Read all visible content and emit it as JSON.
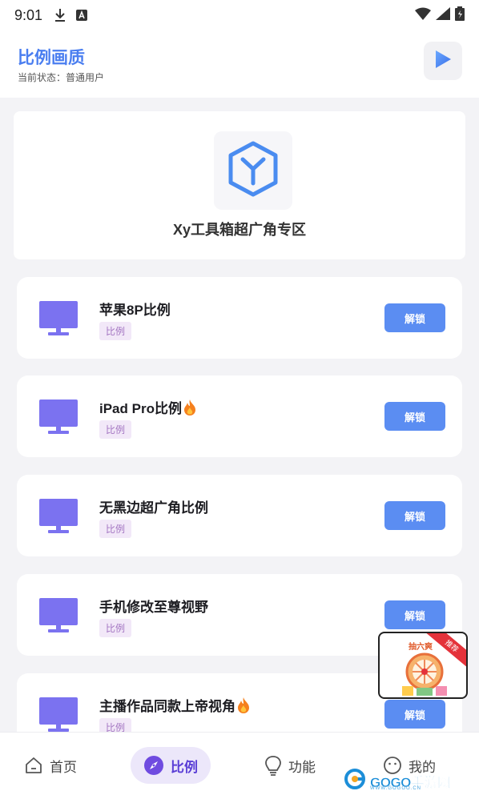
{
  "status_bar": {
    "time": "9:01",
    "icons": [
      "download-icon",
      "notification-a-icon",
      "wifi-icon",
      "signal-icon",
      "battery-icon"
    ]
  },
  "header": {
    "title": "比例画质",
    "subtitle": "当前状态：普通用户",
    "play_icon": "play-icon"
  },
  "hero": {
    "logo_icon": "cube-y-icon",
    "title": "Xy工具箱超广角专区"
  },
  "items": [
    {
      "name": "苹果8P比例",
      "tag": "比例",
      "button": "解锁",
      "hot": false
    },
    {
      "name": "iPad Pro比例",
      "tag": "比例",
      "button": "解锁",
      "hot": true
    },
    {
      "name": "无黑边超广角比例",
      "tag": "比例",
      "button": "解锁",
      "hot": false
    },
    {
      "name": "手机修改至尊视野",
      "tag": "比例",
      "button": "解锁",
      "hot": false
    },
    {
      "name": "主播作品同款上帝视角",
      "tag": "比例",
      "button": "解锁",
      "hot": true
    }
  ],
  "ad": {
    "title": "抽六爽",
    "ribbon": "推荐"
  },
  "tabs": [
    {
      "label": "首页",
      "icon": "home-icon",
      "active": false
    },
    {
      "label": "比例",
      "icon": "compass-icon",
      "active": true
    },
    {
      "label": "功能",
      "icon": "bulb-icon",
      "active": false
    },
    {
      "label": "我的",
      "icon": "smile-icon",
      "active": false
    }
  ],
  "watermark": {
    "text": "GOGO手游网",
    "sub": "WWW.GOGOO.CN"
  },
  "colors": {
    "accent": "#4a7ef0",
    "button": "#5b8df2",
    "monitor": "#7b72f0",
    "tag_bg": "#f2e8f8",
    "tag_text": "#a476c2",
    "active_tab_bg": "#ece7fa"
  }
}
